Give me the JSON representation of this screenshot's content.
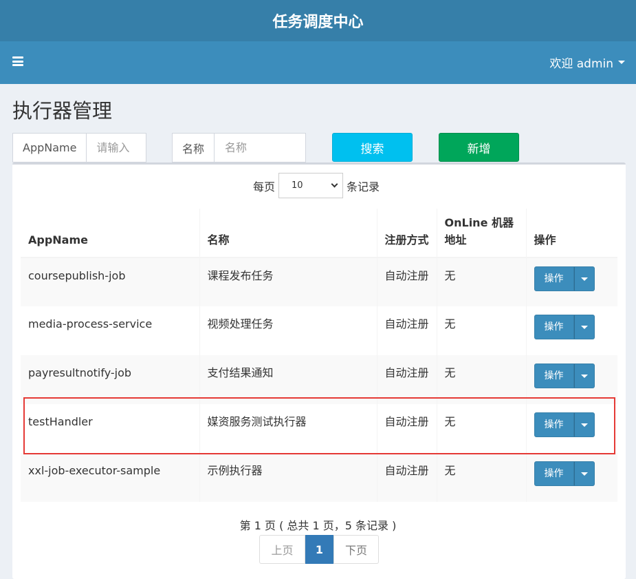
{
  "header": {
    "logo": "任务调度中心",
    "user_label": "欢迎 admin"
  },
  "page": {
    "title": "执行器管理"
  },
  "filters": {
    "appname_label": "AppName",
    "appname_placeholder": "请输入",
    "name_label": "名称",
    "name_placeholder": "名称",
    "search_label": "搜索",
    "add_label": "新增"
  },
  "length_control": {
    "prefix": "每页",
    "value": "10",
    "suffix": "条记录"
  },
  "table": {
    "headers": [
      "AppName",
      "名称",
      "注册方式",
      "OnLine 机器地址",
      "操作"
    ],
    "rows": [
      {
        "appname": "coursepublish-job",
        "name": "课程发布任务",
        "reg": "自动注册",
        "online": "无",
        "action": "操作"
      },
      {
        "appname": "media-process-service",
        "name": "视频处理任务",
        "reg": "自动注册",
        "online": "无",
        "action": "操作"
      },
      {
        "appname": "payresultnotify-job",
        "name": "支付结果通知",
        "reg": "自动注册",
        "online": "无",
        "action": "操作"
      },
      {
        "appname": "testHandler",
        "name": "媒资服务测试执行器",
        "reg": "自动注册",
        "online": "无",
        "action": "操作"
      },
      {
        "appname": "xxl-job-executor-sample",
        "name": "示例执行器",
        "reg": "自动注册",
        "online": "无",
        "action": "操作"
      }
    ]
  },
  "pagination": {
    "info": "第 1 页 ( 总共 1 页，5 条记录 )",
    "prev": "上页",
    "current": "1",
    "next": "下页"
  },
  "colors": {
    "header_dark": "#367fa9",
    "header": "#3c8dbc",
    "search_btn": "#00c0ef",
    "add_btn": "#00a65a",
    "highlight": "#e53935"
  },
  "icons": {
    "menu": "hamburger-icon",
    "user_caret": "caret-down-icon",
    "action_caret": "caret-down-icon"
  }
}
